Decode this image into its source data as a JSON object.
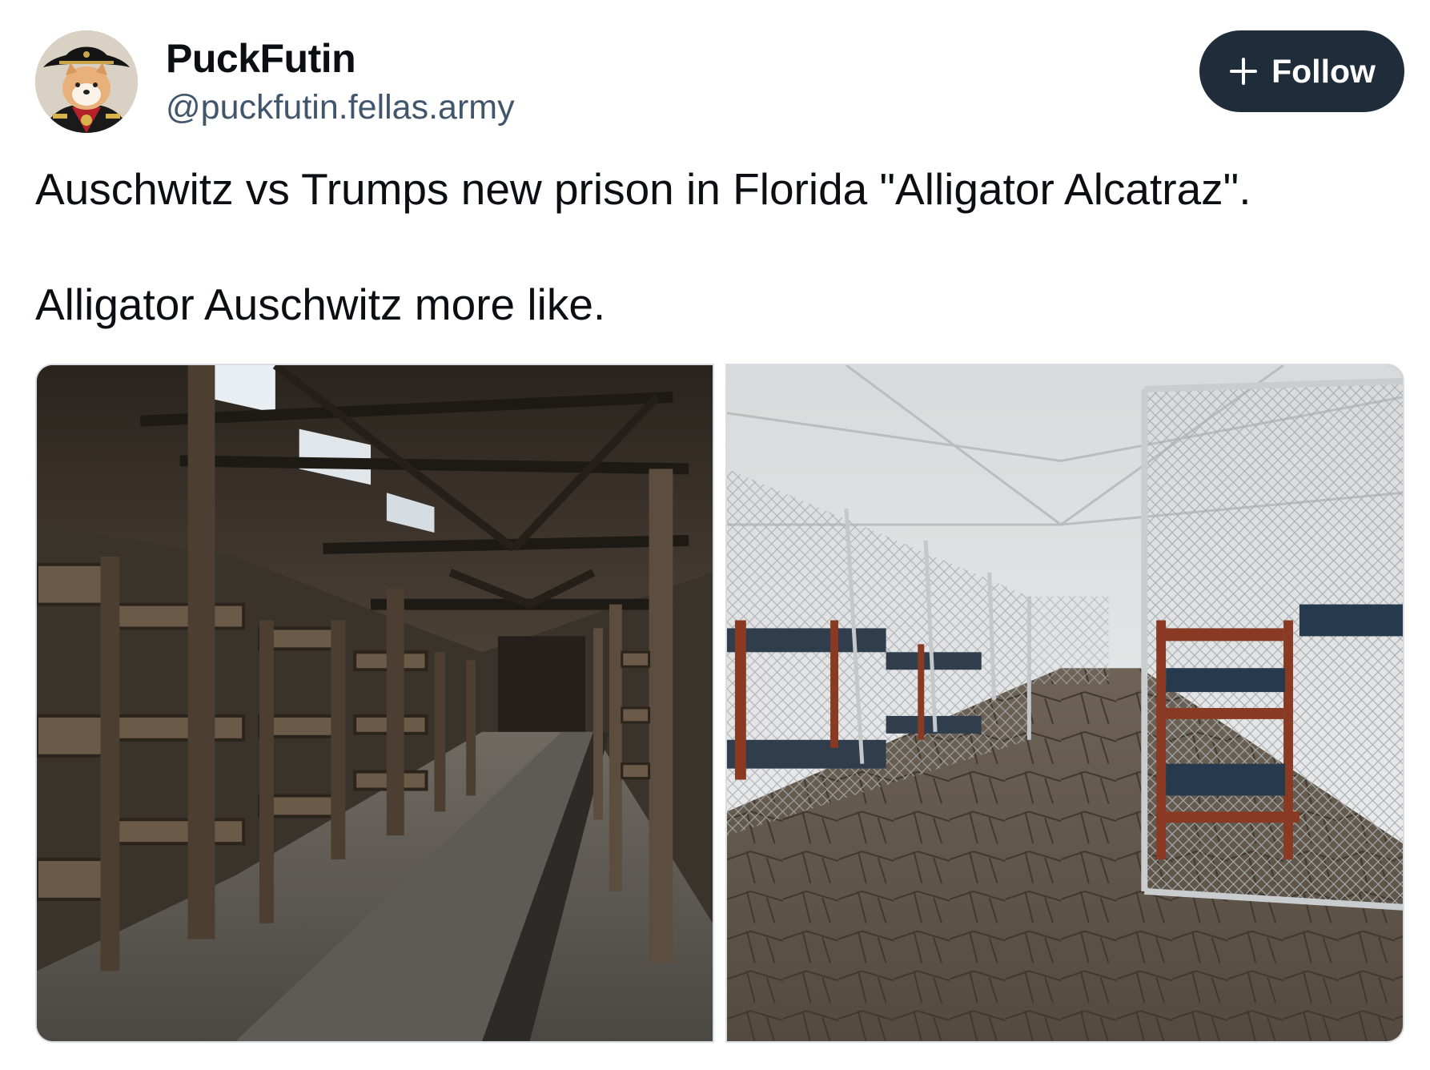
{
  "post": {
    "author": {
      "display_name": "PuckFutin",
      "handle": "@puckfutin.fellas.army",
      "avatar_icon": "shiba-dog-in-bicorne-hat"
    },
    "follow_button": {
      "label": "Follow",
      "icon": "plus-icon"
    },
    "text": [
      "Auschwitz vs Trumps new prison in Florida \"Alligator Alcatraz\".",
      "Alligator Auschwitz more like."
    ],
    "media": [
      {
        "name": "auschwitz-barracks-photo",
        "description_icon": "wooden-bunk-barracks"
      },
      {
        "name": "alligator-alcatraz-photo",
        "description_icon": "fenced-cage-bunks-tent"
      }
    ]
  },
  "colors": {
    "follow_bg": "#1f2d3a",
    "handle": "#42566b",
    "text": "#0b0f14"
  }
}
